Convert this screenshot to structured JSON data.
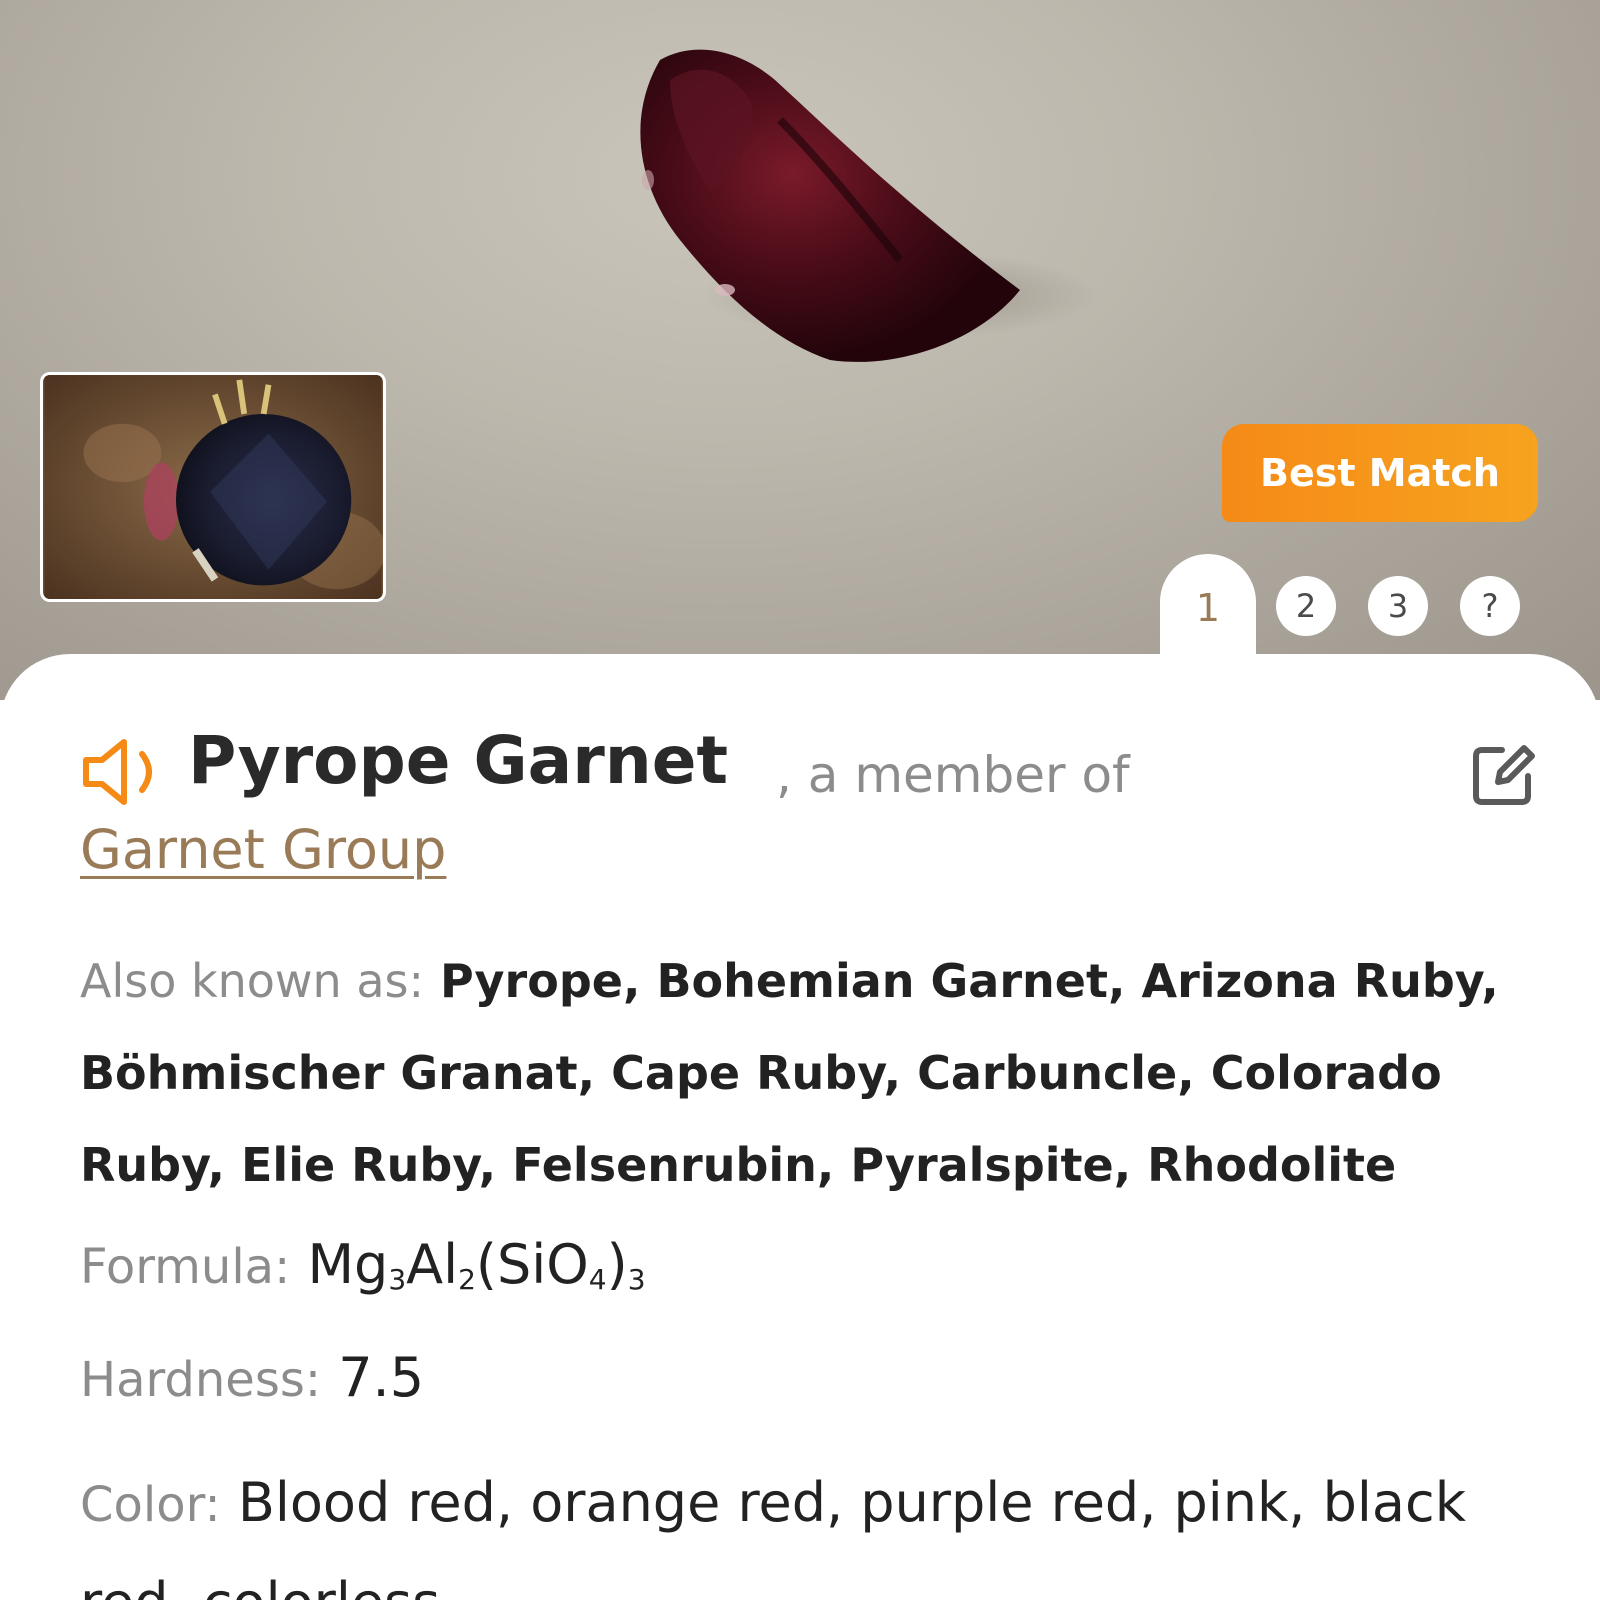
{
  "hero": {
    "best_match_label": "Best Match"
  },
  "match_tabs": [
    {
      "label": "1",
      "active": true
    },
    {
      "label": "2",
      "active": false
    },
    {
      "label": "3",
      "active": false
    },
    {
      "label": "?",
      "active": false
    }
  ],
  "result": {
    "name": "Pyrope Garnet",
    "member_of_text": ", a member of",
    "group_link": "Garnet Group",
    "also_known_as_label": "Also known as:",
    "also_known_as_value": "Pyrope, Bohemian Garnet, Arizona Ruby, Böhmischer Granat, Cape Ruby, Carbuncle, Colorado Ruby, Elie Ruby, Felsenrubin, Pyralspite, Rhodolite",
    "formula_label": "Formula:",
    "formula_parts": [
      "Mg",
      "3",
      "Al",
      "2",
      "(SiO",
      "4",
      ")",
      "3"
    ],
    "hardness_label": "Hardness:",
    "hardness_value": "7.5",
    "color_label": "Color:",
    "color_value": "Blood red, orange red, purple red, pink, black red, colorless"
  },
  "icons": {
    "speaker": "speaker-icon",
    "edit": "edit-icon"
  },
  "colors": {
    "accent_orange": "#f58a17",
    "link_brown": "#9a7b58",
    "label_gray": "#8c8c8c",
    "text_dark": "#222222"
  }
}
